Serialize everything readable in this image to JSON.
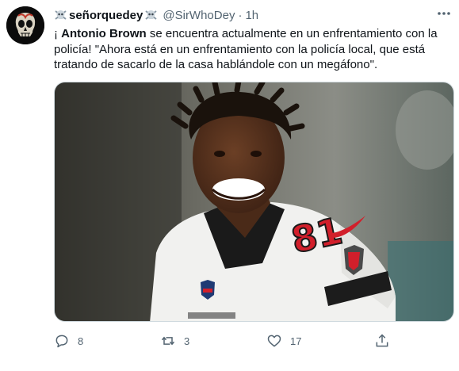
{
  "tweet": {
    "display_name": "señorquedey",
    "handle": "@SirWhoDey",
    "separator": "·",
    "time": "1h",
    "text_intro": "¡",
    "text_bold": "Antonio Brown",
    "text_rest": " se encuentra actualmente en un enfrentamiento con la policía! \"Ahora está en un enfrentamiento con la policía local, que está tratando de sacarlo de la casa hablándole con un megáfono\"."
  },
  "media": {
    "jersey_number": "81"
  },
  "actions": {
    "reply_count": "8",
    "retweet_count": "3",
    "like_count": "17"
  },
  "colors": {
    "text_primary": "#0f1419",
    "text_secondary": "#536471",
    "border": "#cfd9de"
  },
  "icons": [
    "skull-emoji-icon",
    "more-options-icon",
    "reply-icon",
    "retweet-icon",
    "like-icon",
    "share-icon"
  ]
}
